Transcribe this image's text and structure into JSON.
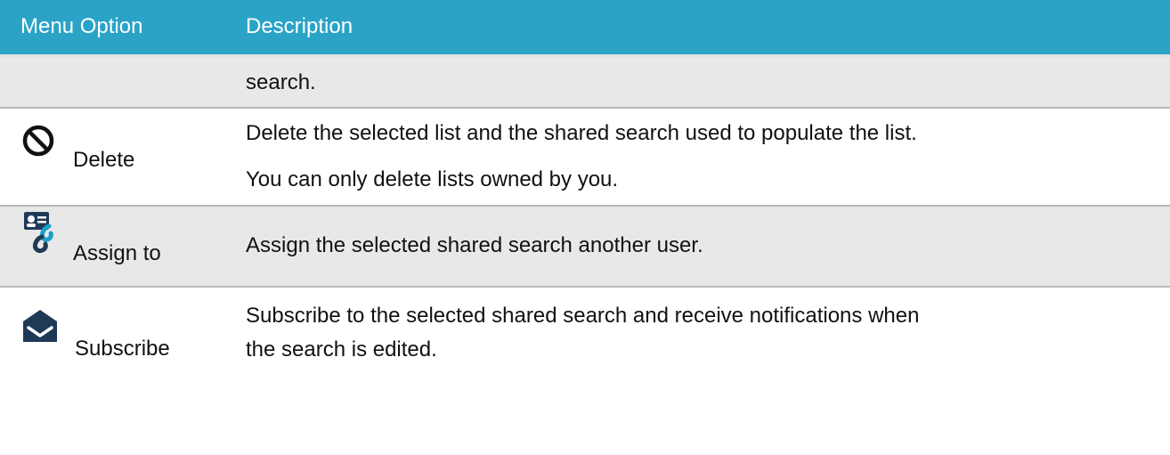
{
  "table": {
    "headers": {
      "option": "Menu Option",
      "description": "Description"
    },
    "rows": [
      {
        "option": "",
        "icon": "",
        "description": [
          "search."
        ]
      },
      {
        "option": "Delete",
        "icon": "prohibited-icon",
        "description": [
          "Delete the selected list and the shared search used to populate the list.",
          "You can only delete lists owned by you."
        ]
      },
      {
        "option": "Assign to",
        "icon": "assign-user-icon",
        "description": [
          "Assign the selected shared search another user."
        ]
      },
      {
        "option": "Subscribe",
        "icon": "subscribe-envelope-icon",
        "description": [
          "Subscribe to the selected shared search and receive notifications when",
          "the search is edited."
        ]
      }
    ]
  },
  "colors": {
    "header_bg": "#2aa3c7",
    "header_text": "#ffffff",
    "shaded_row": "#e8e8e8",
    "assign_icon": "#1aa0c6",
    "subscribe_icon": "#1f3a57"
  }
}
